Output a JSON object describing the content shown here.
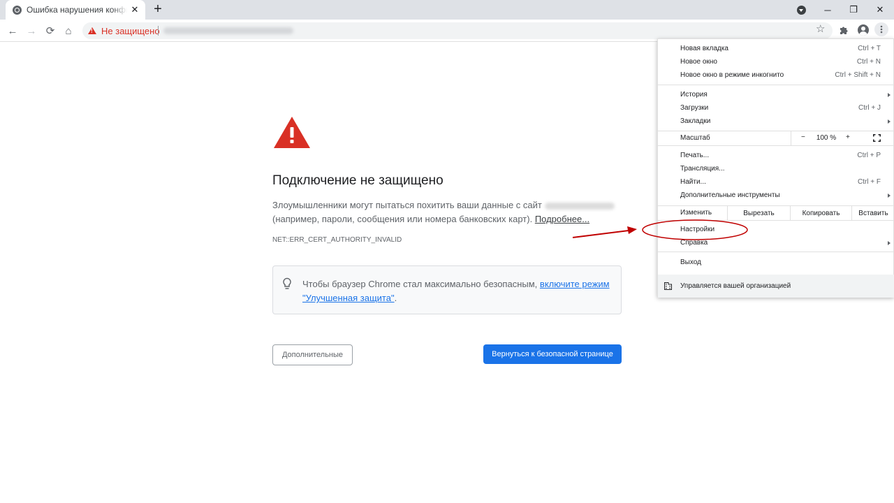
{
  "tab": {
    "title": "Ошибка нарушения конфиденциальности",
    "close": "✕"
  },
  "newtab_label": "+",
  "window_controls": {
    "minimize": "─",
    "maximize": "❐",
    "close": "✕"
  },
  "toolbar": {
    "back": "←",
    "forward": "→",
    "reload": "⟳",
    "home": "⌂"
  },
  "omnibox": {
    "security_label": "Не защищено"
  },
  "icons": {
    "star": "☆",
    "extensions": "puzzle-icon",
    "menu": "⋮"
  },
  "page": {
    "heading": "Подключение не защищено",
    "body_part1": "Злоумышленники могут пытаться похитить ваши данные с сайт",
    "body_part2": "(например, пароли, сообщения или номера банковских карт).",
    "learn_more": "Подробнее...",
    "error_code": "NET::ERR_CERT_AUTHORITY_INVALID",
    "tip_prefix": "Чтобы браузер Chrome стал максимально безопасным,",
    "tip_link": "включите режим \"Улучшенная защита\"",
    "tip_suffix": ".",
    "advanced_button": "Дополнительные",
    "back_button": "Вернуться к безопасной странице"
  },
  "menu": {
    "new_tab": "Новая вкладка",
    "new_tab_sc": "Ctrl + T",
    "new_window": "Новое окно",
    "new_window_sc": "Ctrl + N",
    "incognito": "Новое окно в режиме инкогнито",
    "incognito_sc": "Ctrl + Shift + N",
    "history": "История",
    "downloads": "Загрузки",
    "downloads_sc": "Ctrl + J",
    "bookmarks": "Закладки",
    "zoom": "Масштаб",
    "zoom_minus": "−",
    "zoom_value": "100 %",
    "zoom_plus": "+",
    "print": "Печать...",
    "print_sc": "Ctrl + P",
    "cast": "Трансляция...",
    "find": "Найти...",
    "find_sc": "Ctrl + F",
    "more_tools": "Дополнительные инструменты",
    "edit": "Изменить",
    "cut": "Вырезать",
    "copy": "Копировать",
    "paste": "Вставить",
    "settings": "Настройки",
    "help": "Справка",
    "exit": "Выход",
    "managed": "Управляется вашей организацией"
  },
  "colors": {
    "accent": "#1a73e8",
    "danger": "#d93025",
    "annotation": "#c00000"
  }
}
